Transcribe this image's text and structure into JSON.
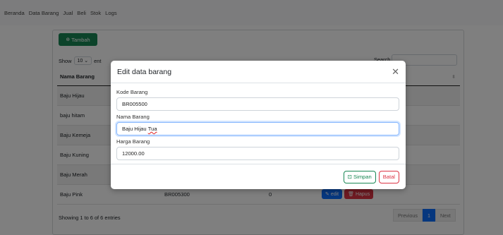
{
  "nav": {
    "items": [
      "Beranda",
      "Data Barang",
      "Jual",
      "Beli",
      "Stok",
      "Logs"
    ]
  },
  "toolbar": {
    "tambah_label": "Tambah",
    "tambah_icon": "plus-circle-icon"
  },
  "datatable": {
    "show_label": "Show",
    "entries_select_value": "10",
    "entries_label_visible": "ent",
    "search_label_visible": "Search",
    "columns": [
      "Nama Barang",
      "",
      "",
      ""
    ],
    "rows": [
      {
        "nama": "Baju Hijau",
        "kode": "",
        "stok": ""
      },
      {
        "nama": "baju hitam",
        "kode": "",
        "stok": ""
      },
      {
        "nama": "Baju Kemeja",
        "kode": "",
        "stok": ""
      },
      {
        "nama": "Baju Kuning",
        "kode": "",
        "stok": ""
      },
      {
        "nama": "Baju Merah",
        "kode": "",
        "stok": ""
      },
      {
        "nama": "Baju Pink",
        "kode": "BR005300",
        "stok": "0"
      }
    ],
    "edit_label": "edit",
    "hapus_label": "Hapus",
    "info": "Showing 1 to 6 of 6 entries",
    "pager": {
      "previous": "Previous",
      "current": "1",
      "next": "Next"
    }
  },
  "modal": {
    "title": "Edit data barang",
    "kode_label": "Kode Barang",
    "kode_value": "BR005500",
    "nama_label": "Nama Barang",
    "nama_value_a": "Baju Hijau ",
    "nama_value_b": "Tua",
    "harga_label": "Harga Barang",
    "harga_value": "12000.00",
    "simpan_label": "Simpan",
    "batal_label": "Batal"
  },
  "colors": {
    "success": "#198754",
    "primary": "#0d6efd",
    "danger": "#dc3545",
    "focus_border": "#86b7fe"
  }
}
